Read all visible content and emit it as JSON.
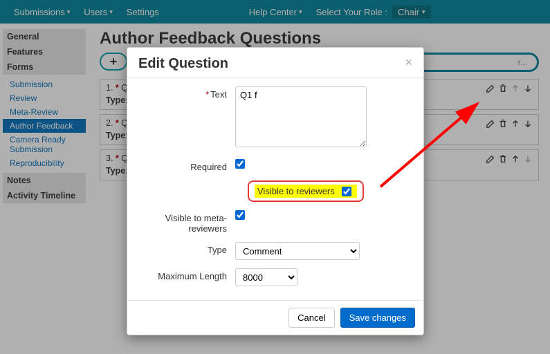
{
  "topnav": {
    "submissions": "Submissions",
    "users": "Users",
    "settings": "Settings",
    "help_center": "Help Center",
    "select_role": "Select Your Role :",
    "role": "Chair"
  },
  "sidebar": {
    "general": "General",
    "features": "Features",
    "forms": "Forms",
    "forms_items": {
      "submission": "Submission",
      "review": "Review",
      "meta_review": "Meta-Review",
      "author_feedback": "Author Feedback",
      "camera_ready": "Camera Ready Submission",
      "reproducibility": "Reproducibility"
    },
    "notes": "Notes",
    "activity": "Activity Timeline"
  },
  "page": {
    "title": "Author Feedback Questions",
    "add": "+",
    "search_placeholder": "r..."
  },
  "rows": {
    "r1_num": "1. ",
    "r1_q": "Q",
    "r2_num": "2. ",
    "r2_q": "Q",
    "r3_num": "3. ",
    "r3_q": "Q",
    "type_label": "Type:",
    "star": "*"
  },
  "modal": {
    "title": "Edit Question",
    "text_label": "Text",
    "text_value": "Q1 f",
    "required_label": "Required",
    "visible_reviewers": "Visible to reviewers",
    "visible_meta": "Visible to meta-reviewers",
    "type_label": "Type",
    "type_value": "Comment",
    "maxlen_label": "Maximum Length",
    "maxlen_value": "8000",
    "cancel": "Cancel",
    "save": "Save changes"
  }
}
